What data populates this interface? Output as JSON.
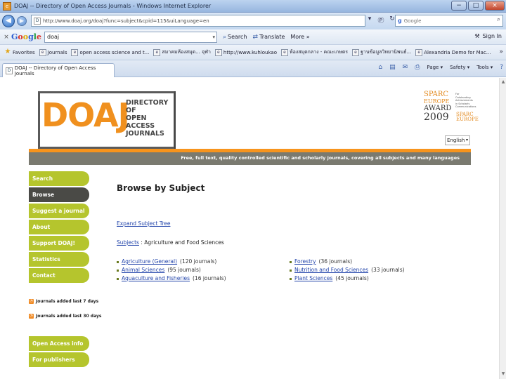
{
  "window": {
    "title": "DOAJ -- Directory of Open Access Journals - Windows Internet Explorer",
    "app_icon_glyph": "e",
    "min_glyph": "−",
    "max_glyph": "□",
    "close_glyph": "×"
  },
  "address_bar": {
    "back_glyph": "◀",
    "fwd_glyph": "▶",
    "page_icon": "D",
    "url": "http://www.doaj.org/doaj?func=subject&cpid=115&uiLanguage=en",
    "search_engine": "Google",
    "search_placeholder": "Google",
    "search_glyph": "⌕",
    "tools": [
      "▾",
      "Ⓟ",
      "↻",
      "×"
    ]
  },
  "google_toolbar": {
    "close_glyph": "×",
    "query": "doaj",
    "dropdown_glyph": "▾",
    "search_label": "Search",
    "search_glyph": "⌕",
    "translate_label": "Translate",
    "translate_glyph": "⇄",
    "more_label": "More »",
    "signin_label": "Sign In",
    "wrench_glyph": "⚒"
  },
  "favorites": {
    "items": [
      {
        "label": "Favorites",
        "icon": "★"
      },
      {
        "label": "Journals",
        "icon": "e"
      },
      {
        "label": "open access science and t...",
        "icon": "e"
      },
      {
        "label": "สมาคมห้องสมุด... จุฬา",
        "icon": "e"
      },
      {
        "label": "http://www.kuhloukao",
        "icon": "e"
      },
      {
        "label": "ห้องสมุดกลาง - คณะเกษตร",
        "icon": "e"
      },
      {
        "label": "ฐานข้อมูลวิทยานิพนธ์...",
        "icon": "e"
      },
      {
        "label": "Alexandria Demo for Mac...",
        "icon": "e"
      }
    ],
    "more_glyph": "»"
  },
  "tabs": {
    "active": {
      "label": "DOAJ -- Directory of Open Access Journals",
      "icon": "D"
    },
    "commands": [
      {
        "icon": "⌂",
        "label": ""
      },
      {
        "icon": "▤",
        "label": ""
      },
      {
        "icon": "✉",
        "label": ""
      },
      {
        "icon": "⎙",
        "label": ""
      },
      {
        "icon": "",
        "label": "Page ▾"
      },
      {
        "icon": "",
        "label": "Safety ▾"
      },
      {
        "icon": "",
        "label": "Tools ▾"
      },
      {
        "icon": "?",
        "label": ""
      }
    ]
  },
  "header": {
    "logo_text": "DOAJ",
    "logo_sub": [
      "DIRECTORY OF",
      "OPEN ACCESS",
      "JOURNALS"
    ],
    "sparc": {
      "line1": "SPARC",
      "line2": "EUROPE",
      "line3": "AWARD",
      "year": "2009",
      "side": "For Outstanding Achievements in Scholarly Communications",
      "logo": "SPARC EUROPE"
    },
    "language": "English",
    "language_arrow": "▾",
    "tagline": "Free, full text, quality controlled scientific and scholarly journals, covering all subjects and many languages"
  },
  "nav": {
    "items": [
      {
        "label": "Search",
        "active": false
      },
      {
        "label": "Browse",
        "active": true
      },
      {
        "label": "Suggest a journal",
        "active": false
      },
      {
        "label": "About",
        "active": false
      },
      {
        "label": "Support DOAJ!",
        "active": false
      },
      {
        "label": "Statistics",
        "active": false
      },
      {
        "label": "Contact",
        "active": false
      }
    ],
    "feeds": [
      "Journals added last 7 days",
      "Journals added last 30 days"
    ],
    "feed_icon": "◔",
    "bottom": [
      "Open Access info",
      "For publishers"
    ]
  },
  "content": {
    "heading": "Browse by Subject",
    "expand": "Expand Subject Tree",
    "breadcrumb": {
      "root": "Subjects",
      "sep": ":",
      "current": "Agriculture and Food Sciences"
    },
    "left": [
      {
        "name": "Agriculture (General)",
        "count": "(120 journals)"
      },
      {
        "name": "Animal Sciences",
        "count": "(95 journals)"
      },
      {
        "name": "Aquaculture and Fisheries",
        "count": "(16 journals)"
      }
    ],
    "right": [
      {
        "name": "Forestry",
        "count": "(36 journals)"
      },
      {
        "name": "Nutrition and Food Sciences",
        "count": "(33 journals)"
      },
      {
        "name": "Plant Sciences",
        "count": "(45 journals)"
      }
    ]
  },
  "scrollbar": {
    "up": "▲",
    "down": "▼"
  }
}
